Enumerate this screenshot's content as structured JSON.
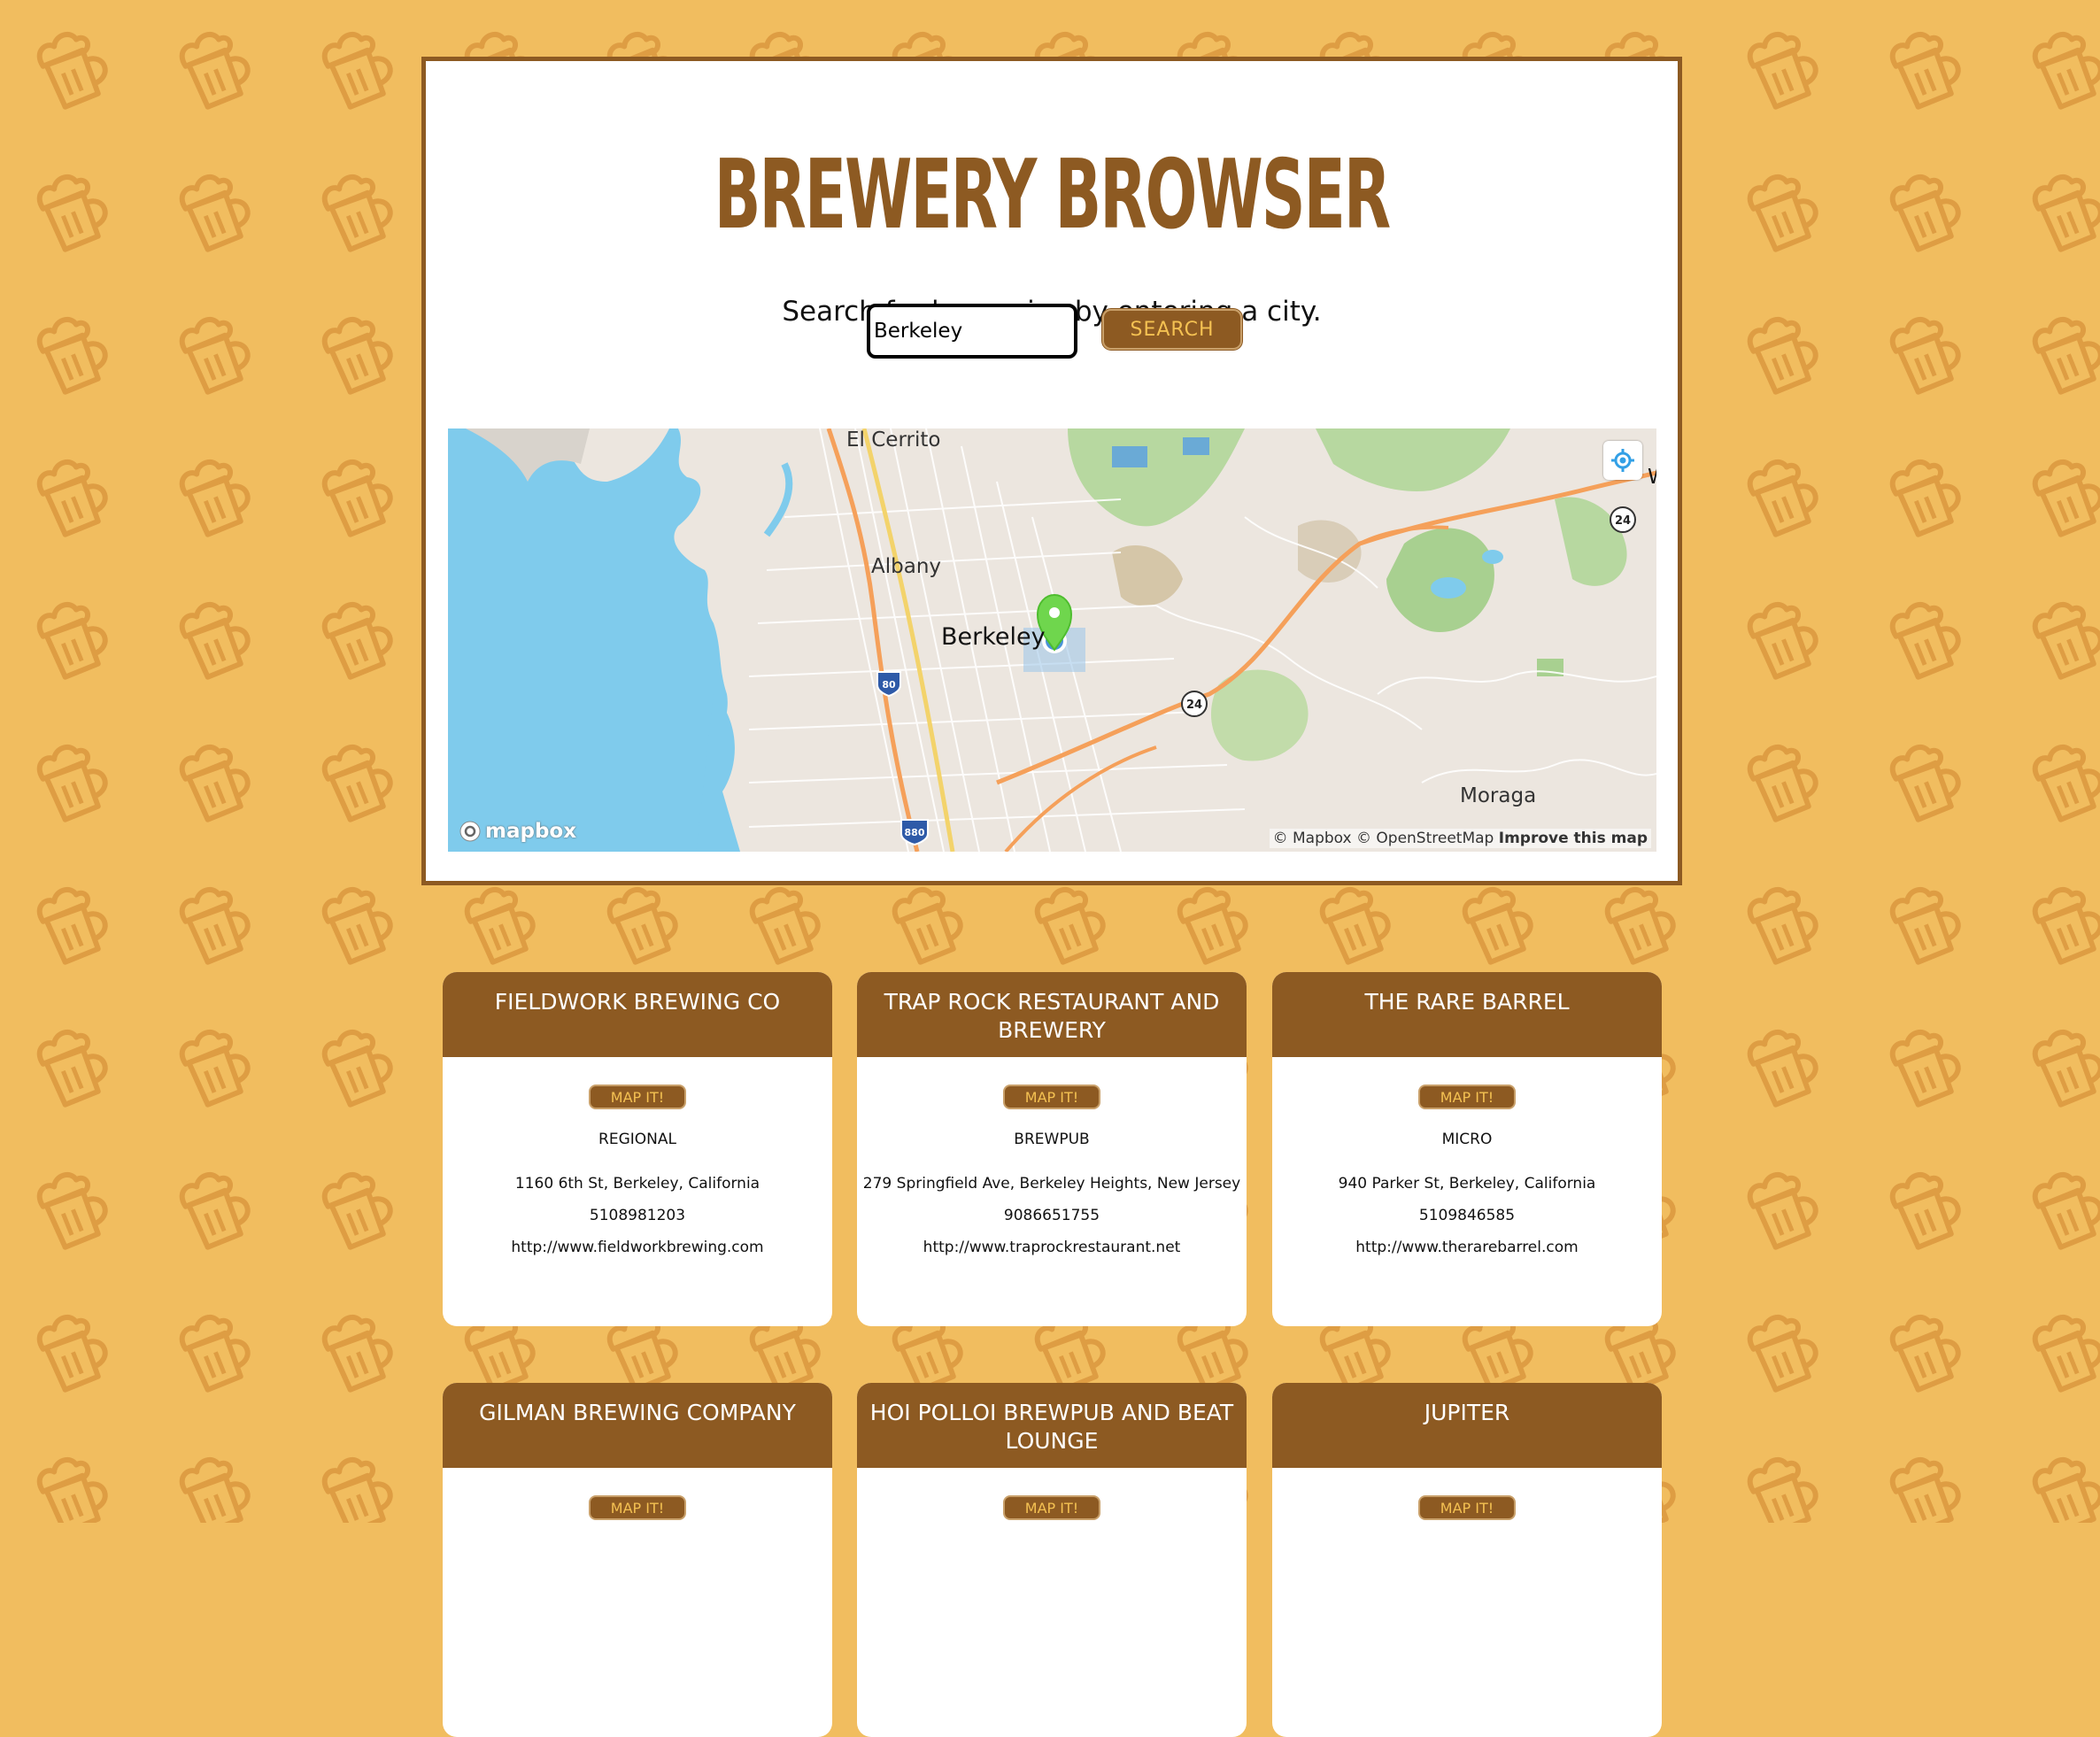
{
  "app": {
    "title": "BREWERY BROWSER",
    "subtitle": "Search for breweries by entering a city."
  },
  "search": {
    "value": "Berkeley",
    "button_label": "SEARCH"
  },
  "map": {
    "labels": {
      "el_cerrito": "El Cerrito",
      "albany": "Albany",
      "berkeley": "Berkeley",
      "moraga": "Moraga",
      "edge_letter": "W"
    },
    "shields": {
      "i80": "80",
      "i880": "880",
      "hwy24_a": "24",
      "hwy24_b": "24"
    },
    "attribution": "© Mapbox © OpenStreetMap",
    "improve_link": "Improve this map",
    "logo_text": "mapbox",
    "icons": [
      "geolocate-icon",
      "map-pin-icon",
      "user-location-icon",
      "mapbox-logo-icon"
    ]
  },
  "breweries": [
    {
      "name": "FIELDWORK BREWING CO",
      "map_button": "MAP IT!",
      "type": "REGIONAL",
      "address": "1160 6th St, Berkeley, California",
      "phone": "5108981203",
      "website": "http://www.fieldworkbrewing.com"
    },
    {
      "name": "TRAP ROCK RESTAURANT AND BREWERY",
      "map_button": "MAP IT!",
      "type": "BREWPUB",
      "address": "279 Springfield Ave, Berkeley Heights, New Jersey",
      "phone": "9086651755",
      "website": "http://www.traprockrestaurant.net"
    },
    {
      "name": "THE RARE BARREL",
      "map_button": "MAP IT!",
      "type": "MICRO",
      "address": "940 Parker St, Berkeley, California",
      "phone": "5109846585",
      "website": "http://www.therarebarrel.com"
    },
    {
      "name": "GILMAN BREWING COMPANY",
      "map_button": "MAP IT!"
    },
    {
      "name": "HOI POLLOI BREWPUB AND BEAT LOUNGE",
      "map_button": "MAP IT!"
    },
    {
      "name": "JUPITER",
      "map_button": "MAP IT!"
    }
  ],
  "background": {
    "pattern_icon": "beer-mug-icon",
    "color": "#f1bd5f",
    "accent": "#8d5a22"
  }
}
